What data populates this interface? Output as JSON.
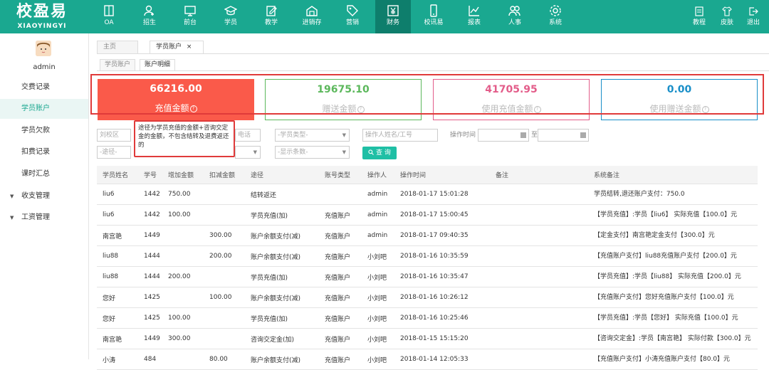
{
  "brand": {
    "name_cn": "校盈易",
    "name_en": "XIAOYINGYI"
  },
  "nav": [
    {
      "label": "OA",
      "icon": "book-icon"
    },
    {
      "label": "招生",
      "icon": "user-add-icon"
    },
    {
      "label": "前台",
      "icon": "monitor-icon"
    },
    {
      "label": "学员",
      "icon": "graduation-cap-icon"
    },
    {
      "label": "教学",
      "icon": "edit-document-icon"
    },
    {
      "label": "进销存",
      "icon": "warehouse-icon"
    },
    {
      "label": "营销",
      "icon": "tag-icon"
    },
    {
      "label": "财务",
      "icon": "yen-icon"
    },
    {
      "label": "校讯易",
      "icon": "phone-icon"
    },
    {
      "label": "报表",
      "icon": "chart-icon"
    },
    {
      "label": "人事",
      "icon": "people-icon"
    },
    {
      "label": "系统",
      "icon": "gear-icon"
    }
  ],
  "top_right": [
    {
      "label": "教程",
      "icon": "tutorial-icon"
    },
    {
      "label": "皮肤",
      "icon": "shirt-icon"
    },
    {
      "label": "退出",
      "icon": "logout-icon"
    }
  ],
  "sidebar": {
    "username": "admin",
    "items": [
      "交费记录",
      "学员账户",
      "学员欠款",
      "扣费记录",
      "课时汇总",
      "收支管理",
      "工资管理"
    ]
  },
  "tabs": {
    "home": "主页",
    "current": "学员账户",
    "close": "×"
  },
  "subtabs": [
    "学员账户",
    "账户明细"
  ],
  "cards": [
    {
      "value": "66216.00",
      "label": "充值金额",
      "color": "#fa5a4a"
    },
    {
      "value": "19675.10",
      "label": "赠送金额",
      "color": "#5cb85c"
    },
    {
      "value": "41705.95",
      "label": "使用充值金额",
      "color": "#e35d8a"
    },
    {
      "value": "0.00",
      "label": "使用赠送金额",
      "color": "#1a8fc8"
    }
  ],
  "tooltip": "途径为学员充值的金额+咨询交定金的金额，不包含结转及退费返还的",
  "filters": {
    "campus": "刘校区",
    "route": "-途径-",
    "phone_suffix": "电话",
    "student_type": "-学员类型-",
    "display_count": "-显示条数-",
    "operator_placeholder": "操作人姓名/工号",
    "op_time_label": "操作时间",
    "to_label": "至",
    "search_label": "查 询"
  },
  "table": {
    "headers": [
      "学员姓名",
      "学号",
      "增加金额",
      "扣减金额",
      "途径",
      "账号类型",
      "操作人",
      "操作时间",
      "备注",
      "系统备注"
    ],
    "rows": [
      [
        "liu6",
        "1442",
        "750.00",
        "",
        "结转返还",
        "",
        "admin",
        "2018-01-17 15:01:28",
        "",
        "学员结转,退还账户支付：750.0"
      ],
      [
        "liu6",
        "1442",
        "100.00",
        "",
        "学员充值(加)",
        "充值账户",
        "admin",
        "2018-01-17 15:00:45",
        "",
        "【学员充值】:学员【liu6】 实际充值【100.0】元"
      ],
      [
        "南宫艳",
        "1449",
        "",
        "300.00",
        "账户余额支付(减)",
        "充值账户",
        "admin",
        "2018-01-17 09:40:35",
        "",
        "【定金支付】南宫艳定金支付【300.0】元"
      ],
      [
        "liu88",
        "1444",
        "",
        "200.00",
        "账户余额支付(减)",
        "充值账户",
        "小刘吧",
        "2018-01-16 10:35:59",
        "",
        "【充值账户支付】liu88充值账户支付【200.0】元"
      ],
      [
        "liu88",
        "1444",
        "200.00",
        "",
        "学员充值(加)",
        "充值账户",
        "小刘吧",
        "2018-01-16 10:35:47",
        "",
        "【学员充值】:学员【liu88】 实际充值【200.0】元"
      ],
      [
        "您好",
        "1425",
        "",
        "100.00",
        "账户余额支付(减)",
        "充值账户",
        "小刘吧",
        "2018-01-16 10:26:12",
        "",
        "【充值账户支付】您好充值账户支付【100.0】元"
      ],
      [
        "您好",
        "1425",
        "100.00",
        "",
        "学员充值(加)",
        "充值账户",
        "小刘吧",
        "2018-01-16 10:25:46",
        "",
        "【学员充值】:学员【您好】 实际充值【100.0】元"
      ],
      [
        "南宫艳",
        "1449",
        "300.00",
        "",
        "咨询交定金(加)",
        "充值账户",
        "小刘吧",
        "2018-01-15 15:15:20",
        "",
        "【咨询交定金】:学员【南宫艳】 实际付款【300.0】元"
      ],
      [
        "小涛",
        "484",
        "",
        "80.00",
        "账户余额支付(减)",
        "充值账户",
        "小刘吧",
        "2018-01-14 12:05:33",
        "",
        "【充值账户支付】小涛充值账户支付【80.0】元"
      ]
    ]
  }
}
